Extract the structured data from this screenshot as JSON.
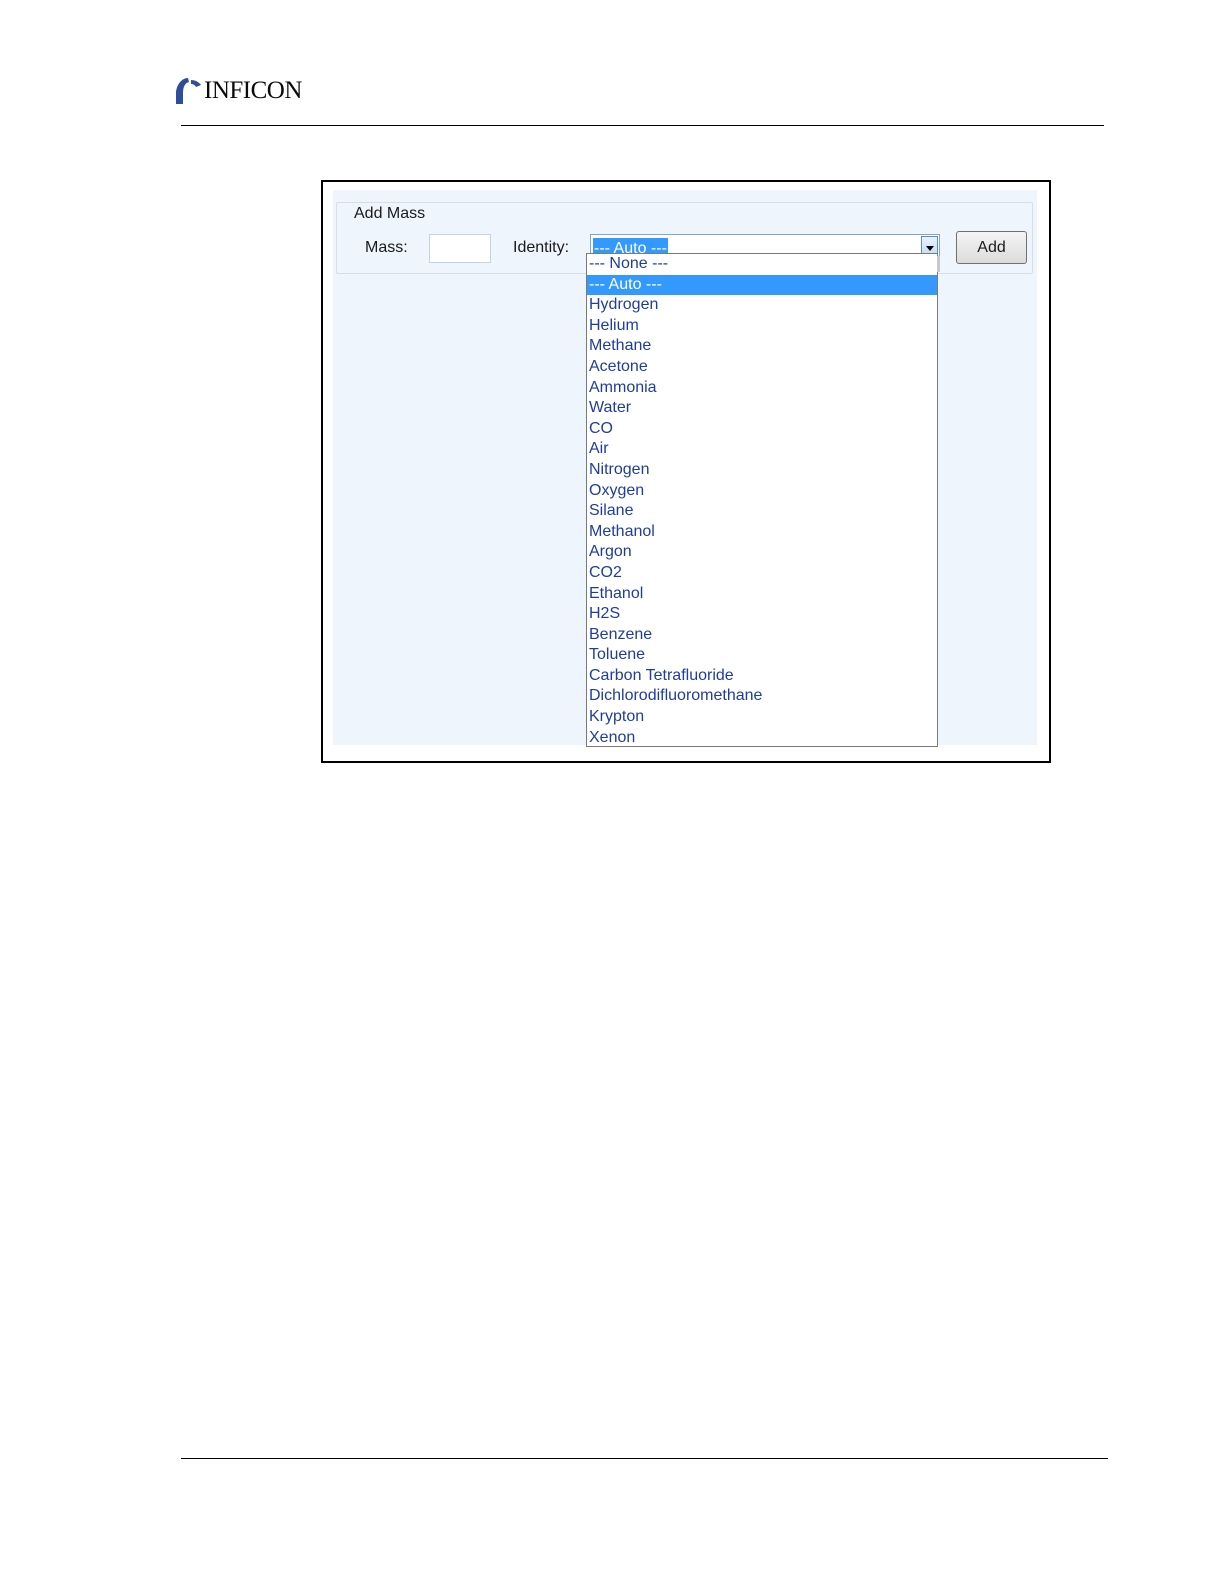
{
  "header": {
    "logo_text": "INFICON"
  },
  "dialog": {
    "group_title": "Add Mass",
    "mass_label": "Mass:",
    "mass_value": "",
    "identity_label": "Identity:",
    "identity_selected": "--- Auto ---",
    "add_button": "Add",
    "options": [
      "--- None ---",
      "--- Auto ---",
      "Hydrogen",
      "Helium",
      "Methane",
      "Acetone",
      "Ammonia",
      "Water",
      "CO",
      "Air",
      "Nitrogen",
      "Oxygen",
      "Silane",
      "Methanol",
      "Argon",
      "CO2",
      "Ethanol",
      "H2S",
      "Benzene",
      "Toluene",
      "Carbon Tetrafluoride",
      "Dichlorodifluoromethane",
      "Krypton",
      "Xenon"
    ],
    "highlighted_index": 1,
    "colors": {
      "panel_bg": "#eef5fd",
      "selection_bg": "#3399ff",
      "option_text": "#1f3d9e"
    },
    "icons": [
      "dropdown-arrow-icon"
    ]
  }
}
